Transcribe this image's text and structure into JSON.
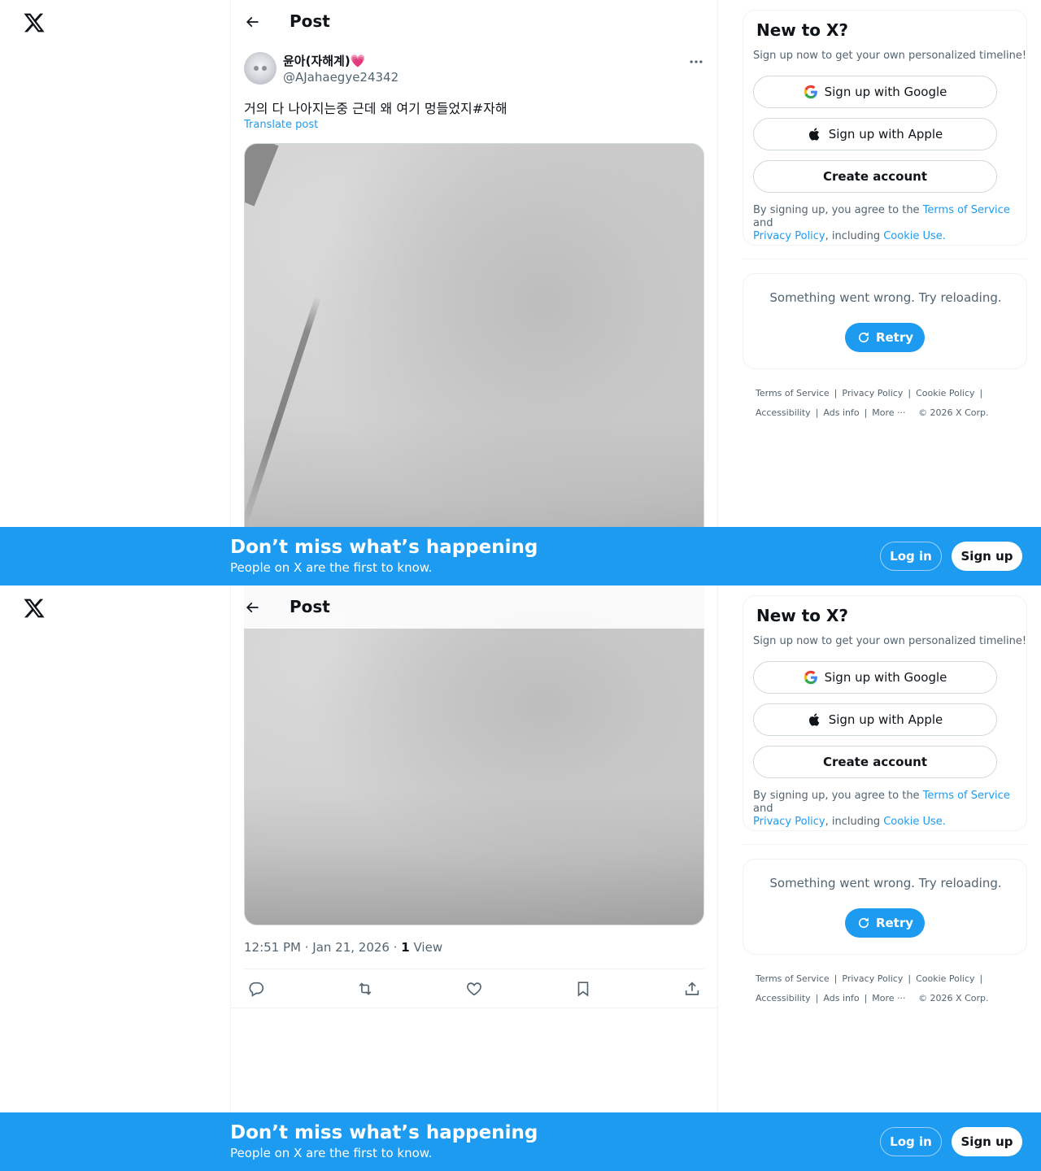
{
  "header": {
    "title": "Post"
  },
  "post": {
    "display_name": "윤아(자해계)",
    "display_emoji": "💗",
    "handle": "@AJahaegye24342",
    "text": "거의 다 나아지는중 근데 왜 여기 멍들었지#자해",
    "translate_label": "Translate post",
    "time": "12:51 PM · Jan 21, 2026 · ",
    "views_count": "1",
    "views_label": " View"
  },
  "signup_card": {
    "title": "New to X?",
    "subtitle": "Sign up now to get your own personalized timeline!",
    "google_label": "Sign up with Google",
    "apple_label": "Sign up with Apple",
    "create_label": "Create account",
    "legal_prefix": "By signing up, you agree to the ",
    "terms_link": "Terms of Service",
    "legal_and": " and",
    "privacy_link": "Privacy Policy",
    "legal_including": ", including ",
    "cookie_link": "Cookie Use."
  },
  "error_card": {
    "message": "Something went wrong. Try reloading.",
    "retry_label": "Retry"
  },
  "footer": {
    "terms": "Terms of Service",
    "privacy": "Privacy Policy",
    "cookie": "Cookie Policy",
    "accessibility": "Accessibility",
    "ads": "Ads info",
    "more": "More ···",
    "copyright": "© 2026 X Corp."
  },
  "banner": {
    "title": "Don’t miss what’s happening",
    "subtitle": "People on X are the first to know.",
    "login_label": "Log in",
    "signup_label": "Sign up"
  },
  "colors": {
    "accent": "#1d9bf0",
    "text": "#0f1419",
    "muted": "#536471",
    "border": "#eff3f4"
  }
}
